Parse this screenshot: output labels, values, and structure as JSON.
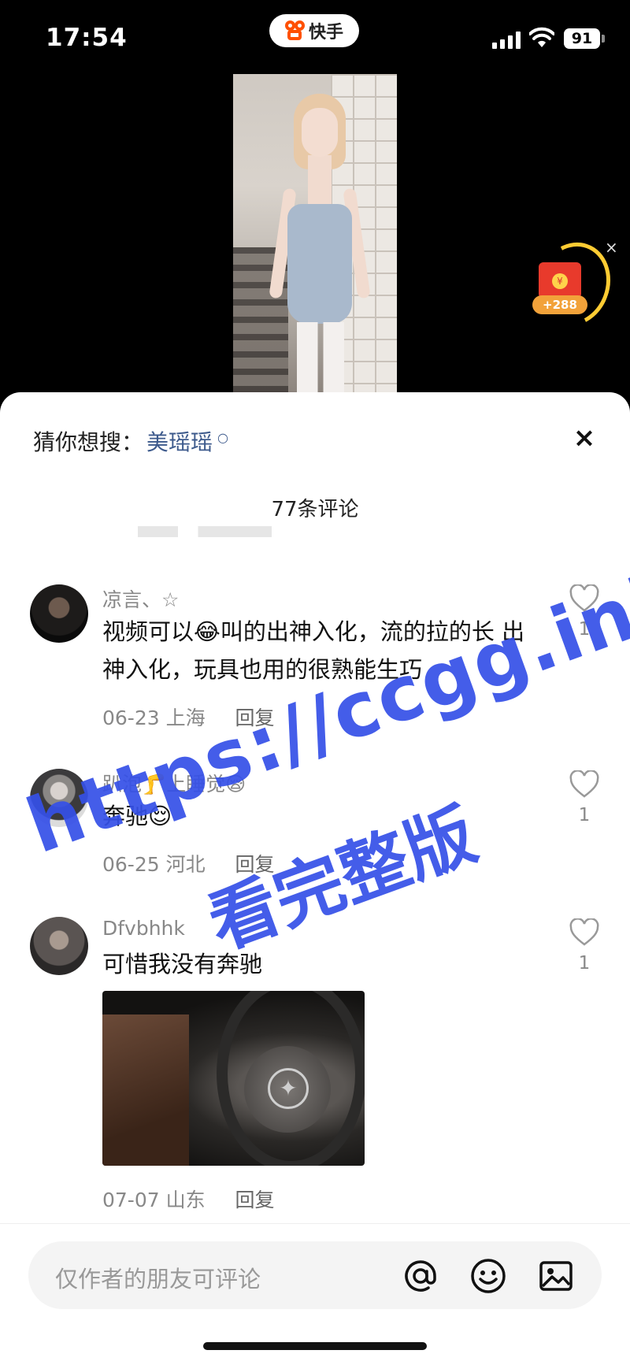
{
  "status_bar": {
    "time": "17:54",
    "app_name": "快手",
    "battery": "91"
  },
  "red_packet": {
    "coin_symbol": "¥",
    "amount": "+288",
    "close": "×"
  },
  "sheet": {
    "guess_label": "猜你想搜：",
    "guess_term": "美瑶瑶",
    "close": "×",
    "comment_count": "77条评论"
  },
  "comments": [
    {
      "name": "凉言、☆",
      "text": "视频可以😂叫的出神入化，流的拉的长  出神入化，玩具也用的很熟能生巧",
      "date": "06-23 上海",
      "reply": "回复",
      "likes": "1"
    },
    {
      "name": "趴泡🦵上睡觉😪",
      "text": "奔驰😌",
      "date": "06-25 河北",
      "reply": "回复",
      "likes": "1"
    },
    {
      "name": "Dfvbhhk",
      "text": "可惜我没有奔驰",
      "date": "07-07 山东",
      "reply": "回复",
      "likes": "1"
    }
  ],
  "watermark": {
    "line1": "https://ccgg.ink",
    "line2": "看完整版"
  },
  "input": {
    "placeholder": "仅作者的朋友可评论"
  },
  "colors": {
    "accent_link": "#3d5a8c",
    "watermark": "#3550e8",
    "brand": "#ff5000"
  }
}
